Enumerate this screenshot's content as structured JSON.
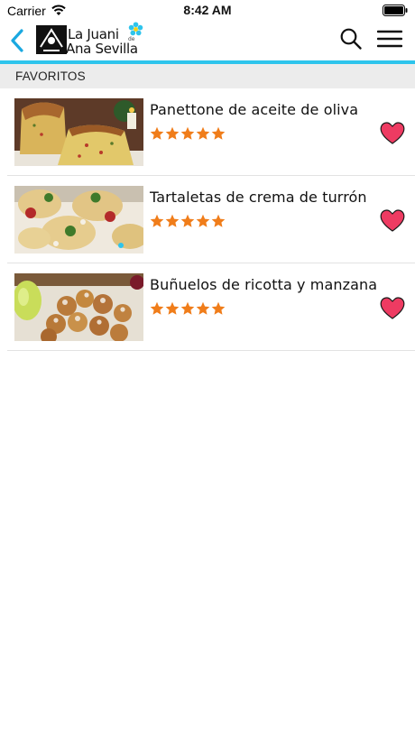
{
  "status_bar": {
    "carrier": "Carrier",
    "time": "8:42 AM"
  },
  "header": {
    "logo_line1": "La Juani",
    "logo_de": "de",
    "logo_line2": "Ana Sevilla",
    "accent_color": "#2ec4ec",
    "icons": [
      "back-chevron-icon",
      "search-icon",
      "hamburger-menu-icon"
    ]
  },
  "section": {
    "title": "FAVORITOS"
  },
  "recipes": [
    {
      "title": "Panettone de aceite de oliva",
      "rating": 5,
      "favorite": true
    },
    {
      "title": "Tartaletas de crema de turrón",
      "rating": 5,
      "favorite": true
    },
    {
      "title": "Buñuelos de ricotta y manzana",
      "rating": 5,
      "favorite": true
    }
  ],
  "colors": {
    "star": "#f07d1a",
    "heart": "#ee3b62",
    "back_arrow": "#1aa8e0"
  }
}
